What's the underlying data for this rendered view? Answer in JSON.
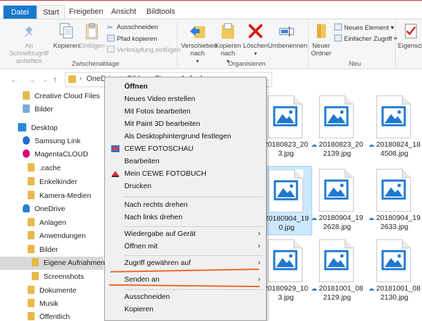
{
  "ribbon_tabs": [
    "Datei",
    "Start",
    "Freigeben",
    "Ansicht",
    "Bildtools"
  ],
  "ribbon": {
    "pin": "An Schnellzugriff anheften",
    "copy": "Kopieren",
    "paste": "Einfügen",
    "cut": "Ausschneiden",
    "copy_path": "Pfad kopieren",
    "paste_shortcut": "Verknüpfung einfügen",
    "group_clipboard": "Zwischenablage",
    "move_to": "Verschieben nach",
    "copy_to": "Kopieren nach",
    "delete": "Löschen",
    "rename": "Umbenennen",
    "group_organize": "Organisieren",
    "new_folder": "Neuer Ordner",
    "new_item": "Neues Element",
    "easy_access": "Einfacher Zugriff",
    "group_new": "Neu",
    "properties": "Eigenschaften"
  },
  "address": {
    "path": "OneDrive > Bilder > Eigene Aufnahmen"
  },
  "nav": [
    {
      "label": "Creative Cloud Files",
      "icon": "folder-icon"
    },
    {
      "label": "Bilder",
      "icon": "pictures-icon"
    },
    {
      "label": "Desktop",
      "icon": "desktop-icon"
    },
    {
      "label": "Samsung Link",
      "icon": "samsung-link-icon"
    },
    {
      "label": "MagentaCLOUD",
      "icon": "magenta-cloud-icon"
    },
    {
      "label": ".cache",
      "icon": "folder-icon"
    },
    {
      "label": "Enkelkinder",
      "icon": "folder-icon"
    },
    {
      "label": "Kamera-Medien",
      "icon": "folder-icon"
    },
    {
      "label": "OneDrive",
      "icon": "onedrive-icon"
    },
    {
      "label": "Anlagen",
      "icon": "folder-icon"
    },
    {
      "label": "Anwendungen",
      "icon": "folder-icon"
    },
    {
      "label": "Bilder",
      "icon": "folder-icon"
    },
    {
      "label": "Eigene Aufnahmen",
      "icon": "folder-icon"
    },
    {
      "label": "Screenshots",
      "icon": "folder-icon"
    },
    {
      "label": "Dokumente",
      "icon": "folder-icon"
    },
    {
      "label": "Musik",
      "icon": "folder-icon"
    },
    {
      "label": "Öffentlich",
      "icon": "folder-icon"
    }
  ],
  "files": [
    {
      "line1": "20180823_20",
      "line2": "3.jpg",
      "cloud": false
    },
    {
      "line1": "20180823_20",
      "line2": "2139.jpg",
      "cloud": true
    },
    {
      "line1": "20180824_18",
      "line2": "4508.jpg",
      "cloud": true
    },
    {
      "line1": "20180904_19",
      "line2": "0.jpg",
      "cloud": false
    },
    {
      "line1": "20180904_19",
      "line2": "2628.jpg",
      "cloud": true
    },
    {
      "line1": "20180904_19",
      "line2": "2633.jpg",
      "cloud": true
    },
    {
      "line1": "20180929_10",
      "line2": "3.jpg",
      "cloud": false
    },
    {
      "line1": "20181001_08",
      "line2": "2129.jpg",
      "cloud": true
    },
    {
      "line1": "20181001_08",
      "line2": "2130.jpg",
      "cloud": true
    }
  ],
  "menu": {
    "open": "Öffnen",
    "new_video": "Neues Video erstellen",
    "edit_photos": "Mit Fotos bearbeiten",
    "edit_paint3d": "Mit Paint 3D bearbeiten",
    "set_wallpaper": "Als Desktophintergrund festlegen",
    "cewe_show": "CEWE FOTOSCHAU",
    "edit": "Bearbeiten",
    "cewe_book": "Mein CEWE FOTOBUCH",
    "print": "Drucken",
    "rotate_right": "Nach rechts drehen",
    "rotate_left": "Nach links drehen",
    "play_to": "Wiedergabe auf Gerät",
    "open_with": "Öffnen mit",
    "give_access": "Zugriff gewähren auf",
    "send_to": "Senden an",
    "cut": "Ausschneiden",
    "copy": "Kopieren"
  },
  "colors": {
    "accent": "#1979ca",
    "selection": "#cce8ff",
    "highlight_line": "#e8692c",
    "folder": "#e6b94a"
  }
}
